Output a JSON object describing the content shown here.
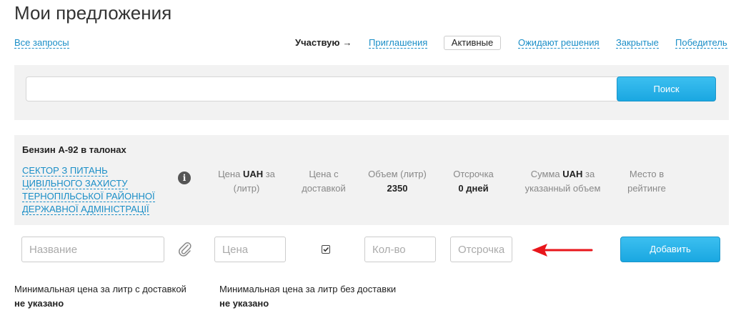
{
  "header": {
    "title": "Мои предложения"
  },
  "nav": {
    "all_requests": "Все запросы",
    "participating": "Участвую",
    "participating_arrow": "→",
    "tabs": {
      "invites": "Приглашения",
      "active": "Активные",
      "pending": "Ожидают решения",
      "closed": "Закрытые",
      "winners": "Победитель"
    }
  },
  "search": {
    "value": "",
    "placeholder": "",
    "button_label": "Поиск"
  },
  "offer": {
    "product": "Бензин А-92 в талонах",
    "organization": "СЕКТОР З ПИТАНЬ ЦИВІЛЬНОГО ЗАХИСТУ ТЕРНОПІЛЬСЬКОЇ РАЙОННОЇ ДЕРЖАВНОЇ АДМІНІСТРАЦІЇ",
    "info_icon_glyph": "i",
    "columns": {
      "price_prefix": "Цена ",
      "price_currency": "UAH",
      "price_suffix": " за (литр)",
      "price_delivery": "Цена с доставкой",
      "volume_label": "Объем (литр)",
      "volume_value": "2350",
      "deferral_label": "Отсрочка",
      "deferral_value": "0 дней",
      "sum_prefix": "Сумма ",
      "sum_currency": "UAH",
      "sum_suffix": " за указанный объем",
      "rating": "Место в рейтинге"
    }
  },
  "form": {
    "name_placeholder": "Название",
    "price_placeholder": "Цена",
    "quantity_placeholder": "Кол-во",
    "deferral_placeholder": "Отсрочка",
    "delivery_checked": true,
    "add_button_label": "Добавить"
  },
  "min_prices": {
    "with_delivery_label": "Минимальная цена за литр с доставкой",
    "with_delivery_value": "не указано",
    "without_delivery_label": "Минимальная цена за литр без доставки",
    "without_delivery_value": "не указано"
  },
  "colors": {
    "accent": "#1aa7e1",
    "link": "#1a8ec7",
    "arrow": "#e8161b",
    "panel": "#f2f2f2"
  }
}
